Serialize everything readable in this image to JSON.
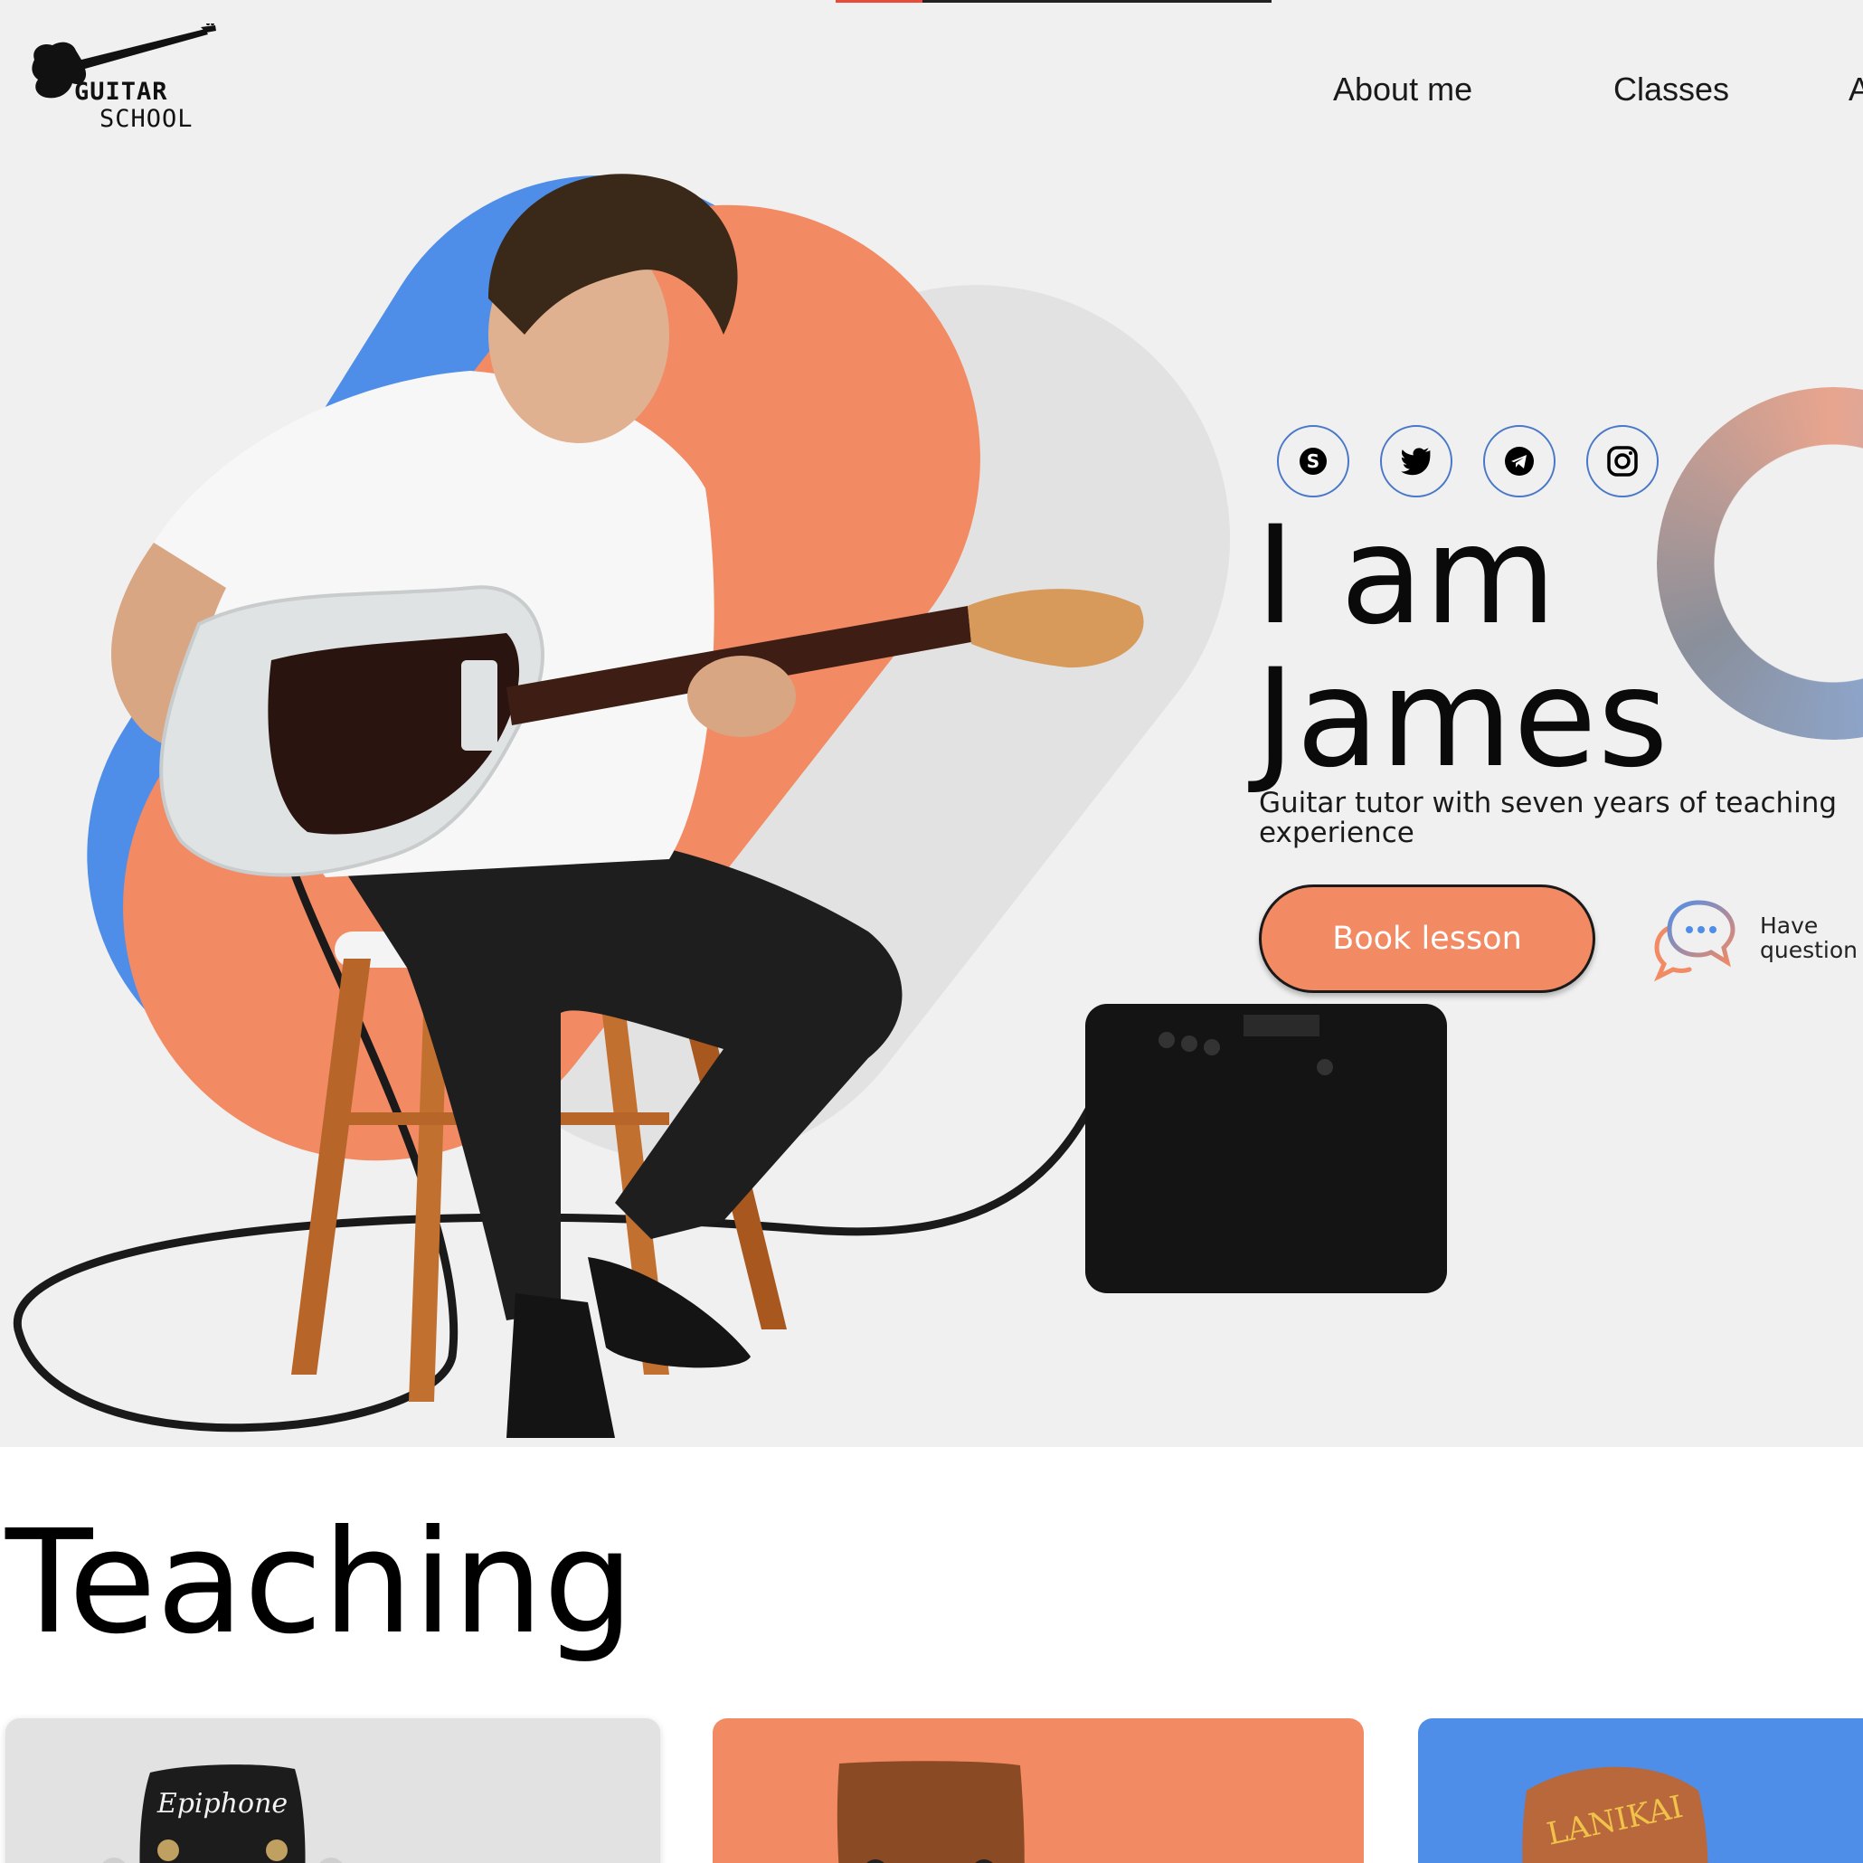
{
  "brand": {
    "logo_line1": "GUITAR",
    "logo_line2": "SCHOOL"
  },
  "nav": {
    "items": [
      "About me",
      "Classes",
      "A"
    ]
  },
  "hero": {
    "progress_fraction": 0.2,
    "title_line1": "I am",
    "title_line2": "James",
    "subtitle": "Guitar tutor with seven years of teaching experience",
    "book_button": "Book lesson",
    "question_text": "Have\nquestion"
  },
  "socials": [
    {
      "icon": "skype-icon"
    },
    {
      "icon": "twitter-icon"
    },
    {
      "icon": "telegram-icon"
    },
    {
      "icon": "instagram-icon"
    }
  ],
  "teaching": {
    "title": "Teaching",
    "cards": [
      {
        "brand": "Epiphone",
        "color": "#e2e2e2"
      },
      {
        "brand": "",
        "color": "#f28a63"
      },
      {
        "brand": "LANIKAI",
        "color": "#4f8ee8"
      }
    ]
  },
  "colors": {
    "accent_orange": "#f28a63",
    "accent_blue": "#4f8ee8",
    "hero_background": "#f0f0f0",
    "progress_red": "#e84b3a"
  }
}
